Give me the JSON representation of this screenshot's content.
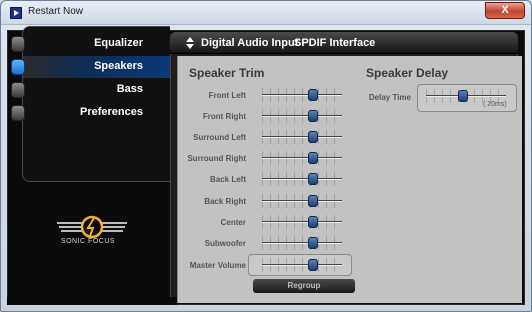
{
  "window": {
    "title": "Restart Now",
    "close_label": "X"
  },
  "nav": {
    "items": [
      {
        "label": "Equalizer",
        "active": false
      },
      {
        "label": "Speakers",
        "active": true
      },
      {
        "label": "Bass",
        "active": false
      },
      {
        "label": "Preferences",
        "active": false
      }
    ]
  },
  "logo": {
    "text": "SONIC FOCUS"
  },
  "tabs": {
    "input": "Digital Audio Input",
    "spdif": "SPDIF Interface"
  },
  "speaker_trim": {
    "title": "Speaker Trim",
    "channels": [
      {
        "label": "Front Left",
        "level": 0.64
      },
      {
        "label": "Front Right",
        "level": 0.64
      },
      {
        "label": "Surround Left",
        "level": 0.64
      },
      {
        "label": "Surround Right",
        "level": 0.64
      },
      {
        "label": "Back Left",
        "level": 0.64
      },
      {
        "label": "Back Right",
        "level": 0.64
      },
      {
        "label": "Center",
        "level": 0.64
      },
      {
        "label": "Subwoofer",
        "level": 0.64
      }
    ],
    "master_label": "Master Volume",
    "master_level": 0.64,
    "regroup_label": "Regroup"
  },
  "speaker_delay": {
    "title": "Speaker Delay",
    "label": "Delay Time",
    "value_text": "( 20ms)",
    "level": 0.46
  }
}
